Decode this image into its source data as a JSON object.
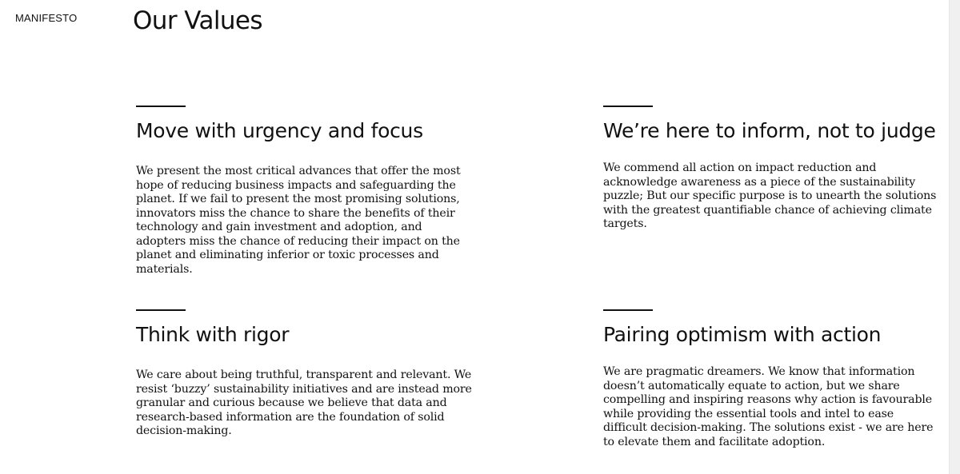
{
  "section_label": "MANIFESTO",
  "page_title": "Our Values",
  "values": [
    {
      "heading": "Move with urgency and focus",
      "body": "We present the most critical advances that offer the most hope of reducing business impacts and safeguarding the planet. If we fail to present the most promising solutions, innovators miss the chance to share the benefits of their technology and gain investment and adoption, and adopters miss the chance of reducing their impact on the planet and eliminating inferior or toxic processes and materials."
    },
    {
      "heading": "We’re here to inform, not to judge",
      "body": "We commend all action on impact reduction and acknowledge awareness as a piece of the sustainability puzzle; But our specific purpose is to unearth the solutions with the greatest quantifiable chance of achieving climate targets."
    },
    {
      "heading": "Think with rigor",
      "body": "We care about being truthful, transparent and relevant. We resist ‘buzzy’ sustainability initiatives and are instead more granular and curious because we believe that data and research-based information are the foundation of solid decision-making."
    },
    {
      "heading": "Pairing optimism with action",
      "body": "We are pragmatic dreamers. We know that information doesn’t automatically equate to action, but we share compelling and inspiring reasons why action is favourable while providing the essential tools and intel to ease difficult decision-making. The solutions exist - we are here to elevate them and facilitate adoption."
    }
  ]
}
